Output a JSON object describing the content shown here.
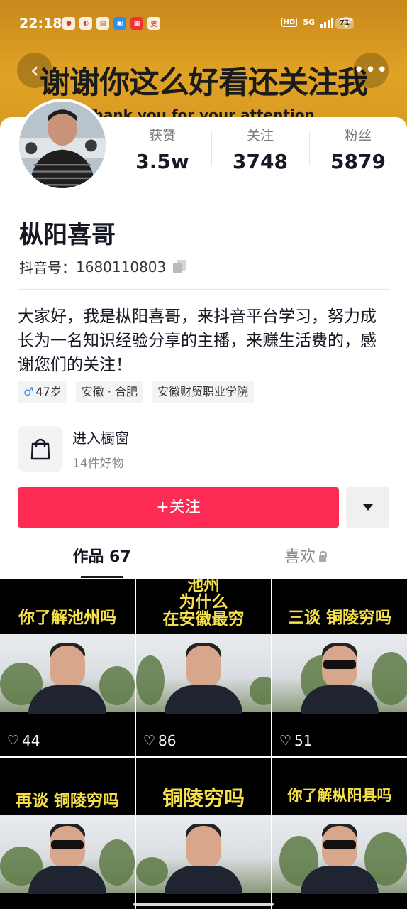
{
  "status_bar": {
    "time": "22:18",
    "battery": "71",
    "network": "5G",
    "hd_label": "HD"
  },
  "banner": {
    "headline": "谢谢你这么好看还关注我",
    "subline": "Thank you for your attention"
  },
  "profile": {
    "name": "枞阳喜哥",
    "douyin_id_label": "抖音号：",
    "douyin_id": "1680110803",
    "stats": [
      {
        "label": "获赞",
        "value": "3.5w"
      },
      {
        "label": "关注",
        "value": "3748"
      },
      {
        "label": "粉丝",
        "value": "5879"
      }
    ],
    "bio": "大家好，我是枞阳喜哥，来抖音平台学习，努力成长为一名知识经验分享的主播，来赚生活费的，感谢您们的关注！",
    "tags": {
      "gender_icon": "♂",
      "age": "47岁",
      "location": "安徽 · 合肥",
      "school": "安徽财贸职业学院"
    }
  },
  "shop": {
    "title": "进入橱窗",
    "subtitle": "14件好物"
  },
  "actions": {
    "follow_label": "+关注"
  },
  "tabs": [
    {
      "label": "作品 67"
    },
    {
      "label": "喜欢"
    }
  ],
  "videos": [
    {
      "title": "你了解池州吗",
      "likes": "44"
    },
    {
      "title_line1": "池州",
      "title_line2": "为什么",
      "title_line3": "在安徽最穷",
      "likes": "86"
    },
    {
      "title": "三谈 铜陵穷吗",
      "likes": "51"
    },
    {
      "title": "再谈 铜陵穷吗"
    },
    {
      "title": "铜陵穷吗"
    },
    {
      "title": "你了解枞阳县吗"
    }
  ],
  "icons": {
    "back": "chevron-left-icon",
    "more": "more-dots-icon",
    "copy": "copy-icon",
    "shop": "shopping-bag-icon",
    "dropdown": "triangle-down-icon",
    "lock": "lock-icon",
    "heart": "heart-icon"
  },
  "colors": {
    "follow_button": "#fe2c55",
    "banner": "#e0a325",
    "caption_yellow": "#f6e04a"
  }
}
